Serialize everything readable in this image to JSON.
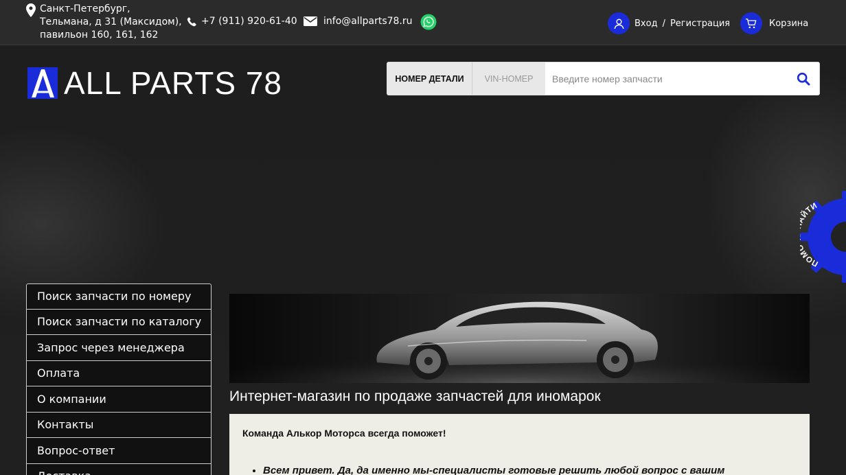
{
  "topbar": {
    "address": [
      "Санкт-Петербург,",
      "Тельмана, д 31 (Максидом),",
      "павильон 160, 161, 162"
    ],
    "phone": "+7 (911) 920-61-40",
    "email": "info@allparts78.ru",
    "login": "Вход",
    "separator": "/",
    "register": "Регистрация",
    "cart": "Корзина",
    "icons": {
      "address": "map-pin-icon",
      "phone": "phone-icon",
      "email": "envelope-icon",
      "messenger": "whatsapp-icon",
      "user": "user-icon",
      "cart": "cart-icon"
    }
  },
  "logo": {
    "text": "ALL PARTS 78"
  },
  "search": {
    "tab_part": "НОМЕР ДЕТАЛИ",
    "tab_vin": "VIN-НОМЕР",
    "placeholder": "Введите номер запчасти"
  },
  "helper": {
    "label": "ПОМОЧЬ НАЙТИ"
  },
  "menu": [
    {
      "label": "Поиск запчасти по номеру"
    },
    {
      "label": "Поиск запчасти по каталогу"
    },
    {
      "label": "Запрос через менеджера"
    },
    {
      "label": "Оплата"
    },
    {
      "label": "О компании"
    },
    {
      "label": "Контакты"
    },
    {
      "label": "Вопрос-ответ"
    },
    {
      "label": "Доставка"
    }
  ],
  "main": {
    "headline": "Интернет-магазин по продаже запчастей для иномарок",
    "lead": "Команда Алькор Моторса всегда поможет!",
    "bullet": "Всем привет. Да, да именно мы-специалисты готовые решить любой вопрос с вашим"
  },
  "colors": {
    "accent": "#1a2bd9",
    "whatsapp": "#25d366",
    "content_bg": "#efeee6"
  }
}
